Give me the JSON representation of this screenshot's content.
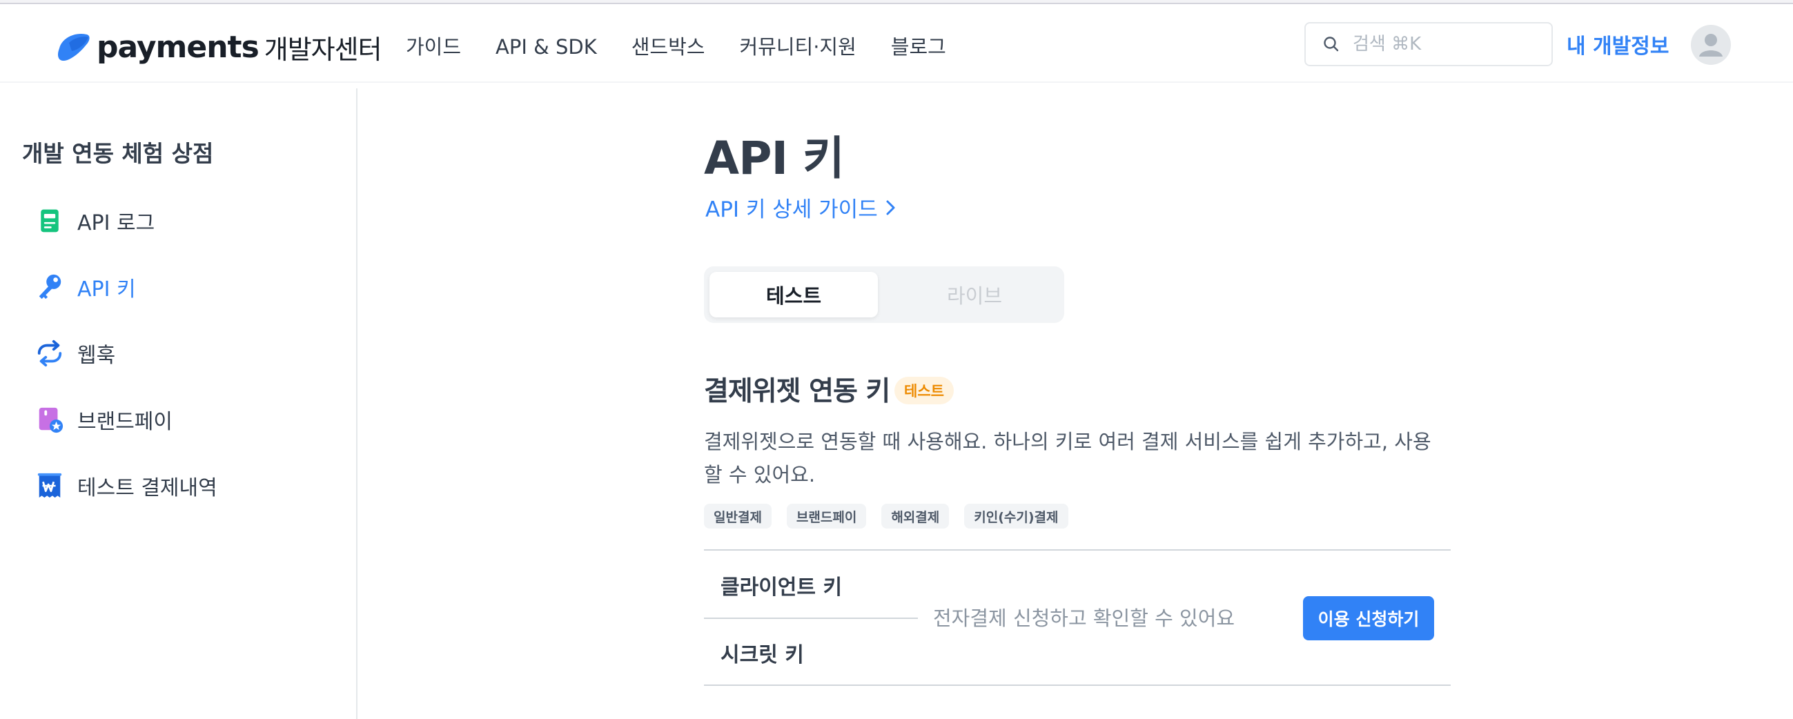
{
  "header": {
    "logo_word": "payments",
    "logo_sub": "개발자센터",
    "nav": [
      "가이드",
      "API & SDK",
      "샌드박스",
      "커뮤니티·지원",
      "블로그"
    ],
    "search_placeholder": "검색 ⌘K",
    "my_dev_label": "내 개발정보",
    "brand_color": "#3182f6"
  },
  "sidebar": {
    "title": "개발 연동 체험 상점",
    "items": [
      {
        "label": "API 로그",
        "icon": "document-icon",
        "active": false
      },
      {
        "label": "API 키",
        "icon": "key-icon",
        "active": true
      },
      {
        "label": "웹훅",
        "icon": "refresh-icon",
        "active": false
      },
      {
        "label": "브랜드페이",
        "icon": "brandpay-icon",
        "active": false
      },
      {
        "label": "테스트 결제내역",
        "icon": "receipt-icon",
        "active": false
      }
    ]
  },
  "main": {
    "title": "API 키",
    "guide_link": "API 키 상세 가이드",
    "tabs": [
      {
        "label": "테스트",
        "selected": true
      },
      {
        "label": "라이브",
        "selected": false
      }
    ],
    "section": {
      "title": "결제위젯 연동 키",
      "badge": "테스트",
      "description": "결제위젯으로 연동할 때 사용해요. 하나의 키로 여러 결제 서비스를 쉽게 추가하고, 사용할 수 있어요.",
      "chips": [
        "일반결제",
        "브랜드페이",
        "해외결제",
        "키인(수기)결제"
      ],
      "client_key_label": "클라이언트 키",
      "secret_key_label": "시크릿 키",
      "message": "전자결제 신청하고 확인할 수 있어요",
      "apply_button": "이용 신청하기"
    }
  }
}
